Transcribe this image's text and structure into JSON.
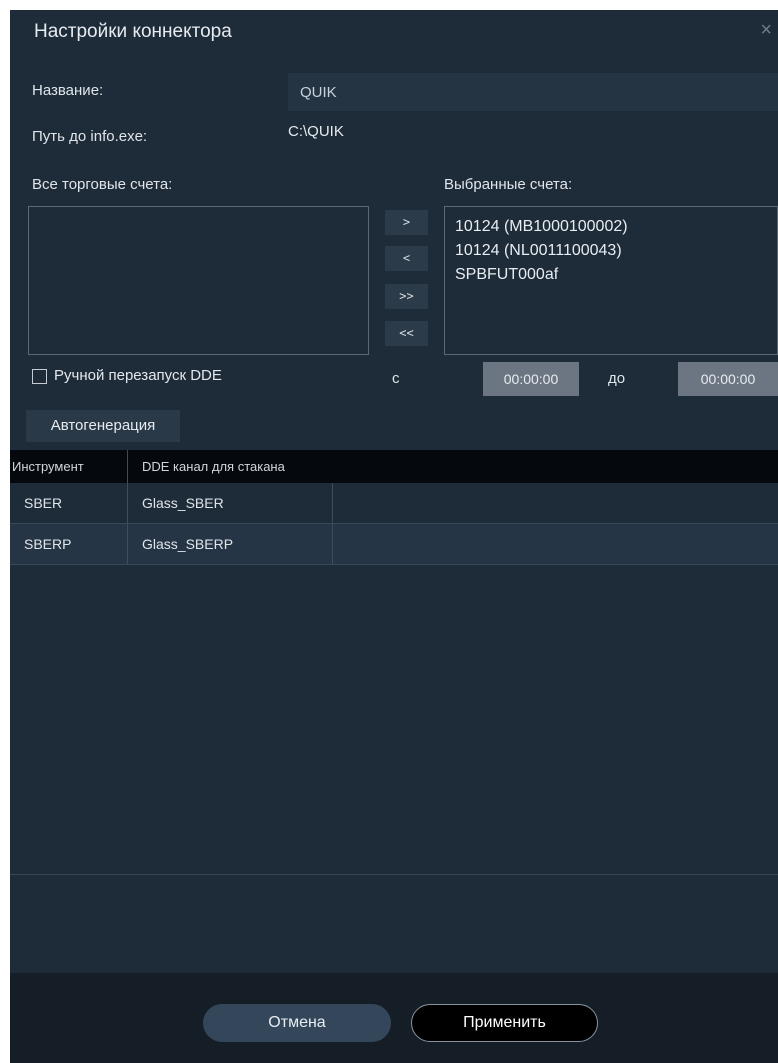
{
  "window": {
    "title": "Настройки коннектора",
    "close_glyph": "×"
  },
  "form": {
    "name_label": "Название:",
    "name_value": "QUIK",
    "path_label": "Путь до info.exe:",
    "path_value": "C:\\QUIK"
  },
  "accounts": {
    "all_label": "Все торговые счета:",
    "selected_label": "Выбранные счета:",
    "all_items": [],
    "selected_items": [
      "10124 (MB1000100002)",
      "10124 (NL0011100043)",
      "SPBFUT000af"
    ],
    "buttons": {
      "add": ">",
      "remove": "<",
      "add_all": ">>",
      "remove_all": "<<"
    }
  },
  "dde": {
    "manual_restart_label": "Ручной перезапуск DDE",
    "manual_restart_checked": false,
    "from_label": "с",
    "from_value": "00:00:00",
    "to_label": "до",
    "to_value": "00:00:00"
  },
  "autogen_label": "Автогенерация",
  "table": {
    "headers": [
      "Инструмент",
      "DDE канал для стакана"
    ],
    "rows": [
      [
        "SBER",
        "Glass_SBER"
      ],
      [
        "SBERP",
        "Glass_SBERP"
      ]
    ],
    "selected_row": 1
  },
  "footer": {
    "cancel_label": "Отмена",
    "apply_label": "Применить"
  },
  "colors": {
    "dialog_bg": "#1e2b38",
    "header_bg": "#05090d",
    "footer_bg": "#151e27",
    "selected_row_bg": "#253545"
  }
}
